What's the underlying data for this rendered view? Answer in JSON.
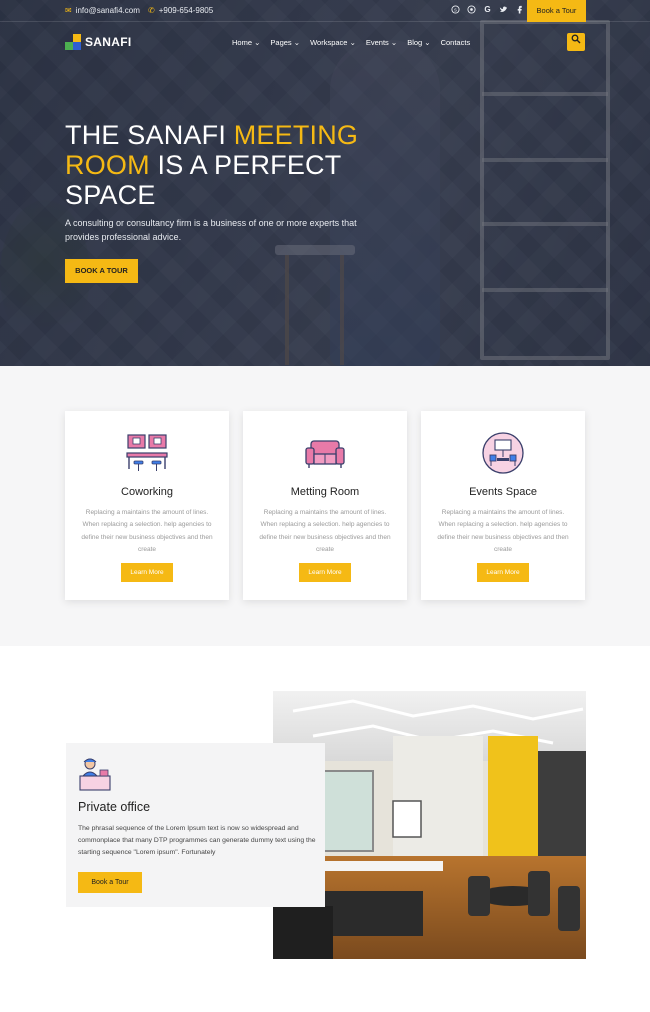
{
  "topbar": {
    "email": "info@sanafi4.com",
    "phone": "+909-654-9805",
    "social_icons": [
      "skype-icon",
      "dribbble-icon",
      "google-icon",
      "twitter-icon",
      "facebook-icon"
    ],
    "book_label": "Book a Tour"
  },
  "header": {
    "logo_text": "SANAFI",
    "nav": [
      "Home",
      "Pages",
      "Workspace",
      "Events",
      "Blog",
      "Contacts"
    ],
    "search_icon": "search-icon"
  },
  "hero": {
    "title_part1": "THE SANAFI ",
    "title_highlight1": "MEETING",
    "title_highlight2": "ROOM",
    "title_part2": " IS A PERFECT SPACE",
    "subtitle": "A consulting or consultancy firm is a business of one or more experts that provides professional advice.",
    "button_label": "BOOK A TOUR"
  },
  "services": [
    {
      "icon": "coworking-icon",
      "title": "Coworking",
      "description": "Replacing a maintains the amount of lines. When replacing a selection. help agencies to define their new business objectives and then create",
      "button_label": "Learn More"
    },
    {
      "icon": "sofa-icon",
      "title": "Metting Room",
      "description": "Replacing a maintains the amount of lines. When replacing a selection. help agencies to define their new business objectives and then create",
      "button_label": "Learn More"
    },
    {
      "icon": "events-space-icon",
      "title": "Events Space",
      "description": "Replacing a maintains the amount of lines. When replacing a selection. help agencies to define their new business objectives and then create",
      "button_label": "Learn More"
    }
  ],
  "private_office": {
    "icon": "reception-desk-icon",
    "title": "Private office",
    "description": "The phrasal sequence of the Lorem Ipsum text is now so widespread and commonplace that many DTP programmes can generate dummy text using the starting sequence \"Lorem ipsum\". Fortunately",
    "button_label": "Book a Tour"
  },
  "colors": {
    "accent": "#f5b914",
    "hero_overlay": "#2a3144",
    "section_bg": "#f6f6f7"
  }
}
